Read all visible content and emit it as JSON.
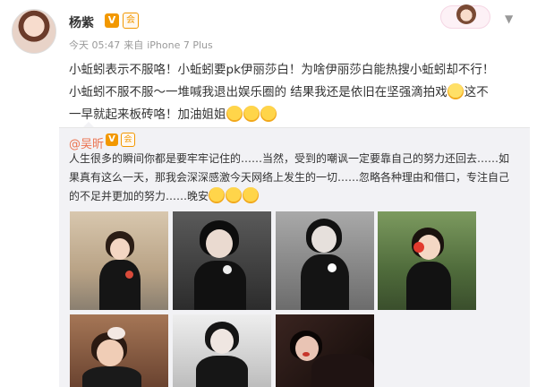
{
  "post": {
    "username": "杨紫",
    "v_badge": "V",
    "vip_badge": "会",
    "time": "今天 05:47",
    "source_prefix": "来自",
    "source": "iPhone 7 Plus",
    "lines": [
      "小蚯蚓表示不服咯！小蚯蚓要pk伊丽莎白！为啥伊丽莎白能热搜小蚯蚓却不行！",
      "小蚯蚓不服不服～一堆喊我退出娱乐圈的 结果我还是依旧在坚强滴拍戏",
      "这不",
      "一早就起来板砖咯！加油姐姐"
    ]
  },
  "repost": {
    "author": "@吴昕",
    "v_badge": "V",
    "vip_badge": "会",
    "lines": [
      "人生很多的瞬间你都是要牢牢记住的……当然，受到的嘲讽一定要靠自己的努力还回去……如",
      "果真有这么一天，那我会深深感激今天网络上发生的一切……忽略各种理由和借口，专注自己",
      "的不足并更加的努力……晚安"
    ],
    "photos": [
      {
        "label": "photo-1",
        "bg": "#c9b79f"
      },
      {
        "label": "photo-2",
        "bg": "#3b3b3b"
      },
      {
        "label": "photo-3",
        "bg": "#8d8d8d"
      },
      {
        "label": "photo-4",
        "bg": "#5d7a47"
      },
      {
        "label": "photo-5",
        "bg": "#8b5a3c"
      },
      {
        "label": "photo-6",
        "bg": "#d8d8d8"
      },
      {
        "label": "photo-7",
        "bg": "#2a1a16"
      }
    ]
  },
  "icons": {
    "chevron": "chevron-down-icon",
    "emoji": "smile-emoji-icon",
    "sweat": "sweat-emoji-icon"
  },
  "colors": {
    "accent": "#eb7350",
    "badge": "#f29800",
    "repost_bg": "#f2f2f5"
  }
}
